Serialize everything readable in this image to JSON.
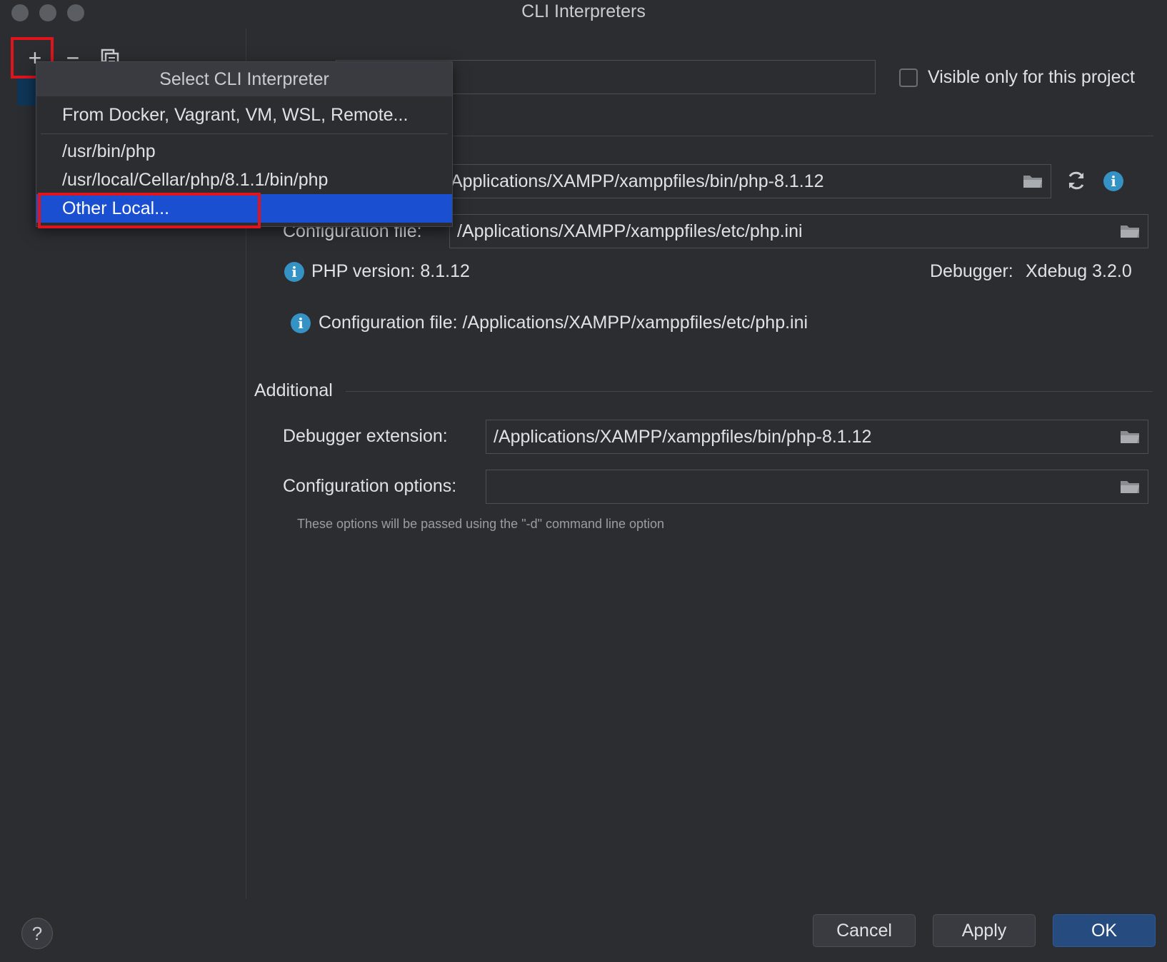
{
  "window": {
    "title": "CLI Interpreters"
  },
  "toolbar": {
    "add": "+",
    "remove": "−"
  },
  "popup": {
    "header": "Select CLI Interpreter",
    "items": [
      "From Docker, Vagrant, VM, WSL, Remote...",
      "/usr/bin/php",
      "/usr/local/Cellar/php/8.1.1/bin/php",
      "Other Local..."
    ]
  },
  "general": {
    "visible_only_label": "Visible only for this project",
    "php_executable_value": "Applications/XAMPP/xamppfiles/bin/php-8.1.12",
    "config_file_label": "Configuration file:",
    "config_file_value": "/Applications/XAMPP/xamppfiles/etc/php.ini",
    "php_version": "PHP version: 8.1.12",
    "debugger_label": "Debugger:",
    "debugger_value": "Xdebug 3.2.0",
    "config_file_info": "Configuration file: /Applications/XAMPP/xamppfiles/etc/php.ini"
  },
  "additional": {
    "section_title": "Additional",
    "debugger_ext_label": "Debugger extension:",
    "debugger_ext_value": "/Applications/XAMPP/xamppfiles/bin/php-8.1.12",
    "config_options_label": "Configuration options:",
    "config_options_value": "",
    "hint": "These options will be passed using the \"-d\" command line option"
  },
  "buttons": {
    "help": "?",
    "cancel": "Cancel",
    "apply": "Apply",
    "ok": "OK"
  }
}
